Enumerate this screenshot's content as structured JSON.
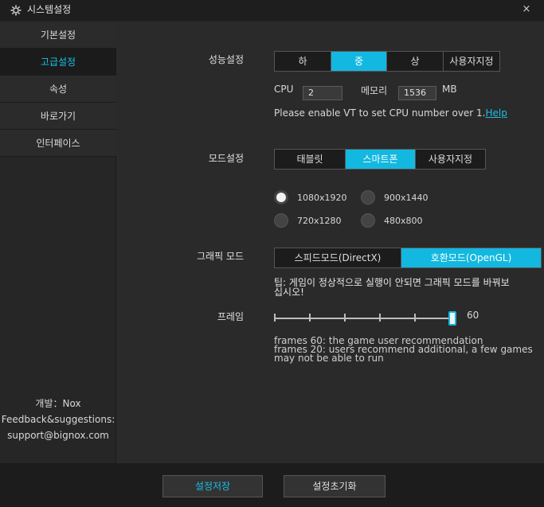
{
  "window": {
    "title": "시스템설정",
    "close_glyph": "×"
  },
  "sidebar": {
    "items": [
      {
        "label": "기본설정",
        "active": false
      },
      {
        "label": "고급설정",
        "active": true
      },
      {
        "label": "속성",
        "active": false
      },
      {
        "label": "바로가기",
        "active": false
      },
      {
        "label": "인터페이스",
        "active": false
      }
    ],
    "footer": {
      "developer": "개발：Nox",
      "feedback": "Feedback&suggestions:",
      "email": "support@bignox.com"
    }
  },
  "performance": {
    "label": "성능설정",
    "options": [
      "하",
      "중",
      "상",
      "사용자지정"
    ],
    "selected": "중",
    "cpu_label": "CPU",
    "cpu_value": "2",
    "memory_label": "메모리",
    "memory_value": "1536",
    "memory_unit": "MB",
    "vt_note": "Please enable VT to set CPU number over 1.",
    "help_link": "Help"
  },
  "mode": {
    "label": "모드설정",
    "options": [
      "태블릿",
      "스마트폰",
      "사용자지정"
    ],
    "selected": "스마트폰",
    "resolutions": [
      {
        "label": "1080x1920",
        "selected": true
      },
      {
        "label": "900x1440",
        "selected": false
      },
      {
        "label": "720x1280",
        "selected": false
      },
      {
        "label": "480x800",
        "selected": false
      }
    ]
  },
  "graphics": {
    "label": "그래픽 모드",
    "options": [
      "스피드모드(DirectX)",
      "호환모드(OpenGL)"
    ],
    "selected": "호환모드(OpenGL)",
    "tip_line1": "팁: 게임이 정상적으로 실행이 안되면 그래픽 모드를 바꿔보",
    "tip_line2": "십시오!"
  },
  "frame": {
    "label": "프레임",
    "value": "60",
    "slider_fraction": 1.0,
    "note_line1": "frames 60: the game user recommendation",
    "note_line2": "frames 20: users recommend additional, a few games",
    "note_line3": "may not be able to run"
  },
  "footer": {
    "save_label": "설정저장",
    "reset_label": "설정초기화"
  },
  "colors": {
    "accent": "#12b8e0",
    "background": "#2a2a2a"
  }
}
